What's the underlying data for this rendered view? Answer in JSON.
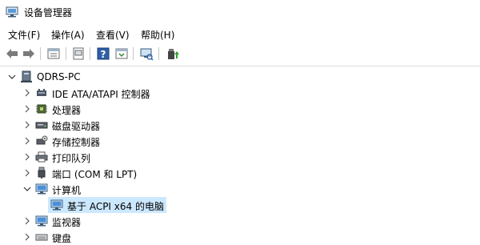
{
  "window": {
    "title": "设备管理器"
  },
  "menu": {
    "items": [
      "文件(F)",
      "操作(A)",
      "查看(V)",
      "帮助(H)"
    ]
  },
  "tree": {
    "root": "QDRS-PC",
    "categories": [
      {
        "label": "IDE ATA/ATAPI 控制器",
        "icon": "ide-controller-icon",
        "expanded": false
      },
      {
        "label": "处理器",
        "icon": "processor-icon",
        "expanded": false
      },
      {
        "label": "磁盘驱动器",
        "icon": "disk-drive-icon",
        "expanded": false
      },
      {
        "label": "存储控制器",
        "icon": "storage-controller-icon",
        "expanded": false
      },
      {
        "label": "打印队列",
        "icon": "printer-icon",
        "expanded": false
      },
      {
        "label": "端口 (COM 和 LPT)",
        "icon": "port-icon",
        "expanded": false
      },
      {
        "label": "计算机",
        "icon": "computer-icon",
        "expanded": true
      },
      {
        "label": "基于 ACPI x64 的电脑",
        "icon": "monitor-icon",
        "child": true,
        "selected": true
      },
      {
        "label": "监视器",
        "icon": "monitor-icon",
        "expanded": false
      },
      {
        "label": "键盘",
        "icon": "keyboard-icon",
        "expanded": false
      }
    ]
  },
  "colors": {
    "selection": "#cce8ff",
    "accent": "#1e6fcf"
  }
}
